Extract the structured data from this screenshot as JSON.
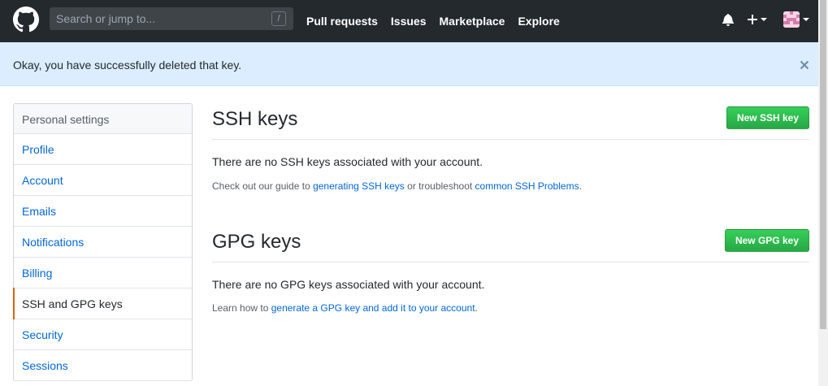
{
  "header": {
    "search_placeholder": "Search or jump to...",
    "search_shortcut": "/",
    "nav": [
      "Pull requests",
      "Issues",
      "Marketplace",
      "Explore"
    ]
  },
  "flash": {
    "message": "Okay, you have successfully deleted that key."
  },
  "sidebar": {
    "header": "Personal settings",
    "items": [
      {
        "label": "Profile"
      },
      {
        "label": "Account"
      },
      {
        "label": "Emails"
      },
      {
        "label": "Notifications"
      },
      {
        "label": "Billing"
      },
      {
        "label": "SSH and GPG keys",
        "selected": true
      },
      {
        "label": "Security"
      },
      {
        "label": "Sessions"
      }
    ]
  },
  "ssh": {
    "title": "SSH keys",
    "button": "New SSH key",
    "empty_message": "There are no SSH keys associated with your account.",
    "note_prefix": "Check out our guide to ",
    "note_link1": "generating SSH keys",
    "note_middle": " or troubleshoot ",
    "note_link2": "common SSH Problems",
    "note_suffix": "."
  },
  "gpg": {
    "title": "GPG keys",
    "button": "New GPG key",
    "empty_message": "There are no GPG keys associated with your account.",
    "note_prefix": "Learn how to ",
    "note_link": "generate a GPG key and add it to your account",
    "note_suffix": "."
  },
  "colors": {
    "header_bg": "#24292e",
    "flash_bg": "#dbedff",
    "link": "#0366d6",
    "button_green": "#28a745",
    "selected_accent": "#e36209"
  }
}
